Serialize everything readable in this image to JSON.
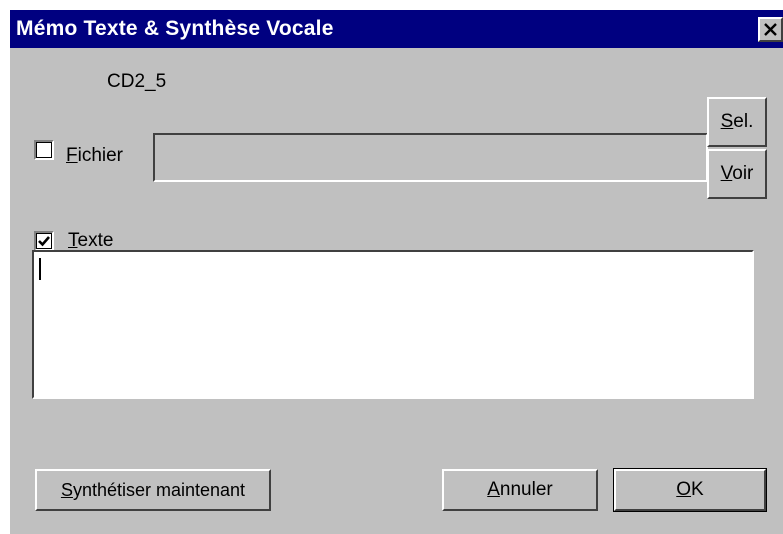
{
  "window": {
    "title": "Mémo Texte & Synthèse Vocale",
    "close_icon": "close-icon"
  },
  "dialog": {
    "item_id": "CD2_5",
    "fichier": {
      "checked": false,
      "label_mnemonic": "F",
      "label_rest": "ichier",
      "path_value": ""
    },
    "buttons": {
      "sel_mnemonic": "S",
      "sel_rest": "el.",
      "voir_mnemonic": "V",
      "voir_rest": "oir"
    },
    "texte": {
      "checked": true,
      "label_mnemonic": "T",
      "label_rest": "exte",
      "content": ""
    },
    "footer": {
      "synth_mnemonic": "S",
      "synth_rest": "ynthétiser maintenant",
      "annuler_mnemonic": "A",
      "annuler_rest": "nnuler",
      "ok_mnemonic": "O",
      "ok_rest": "K"
    }
  },
  "colors": {
    "titlebar": "#000080",
    "face": "#c0c0c0"
  }
}
